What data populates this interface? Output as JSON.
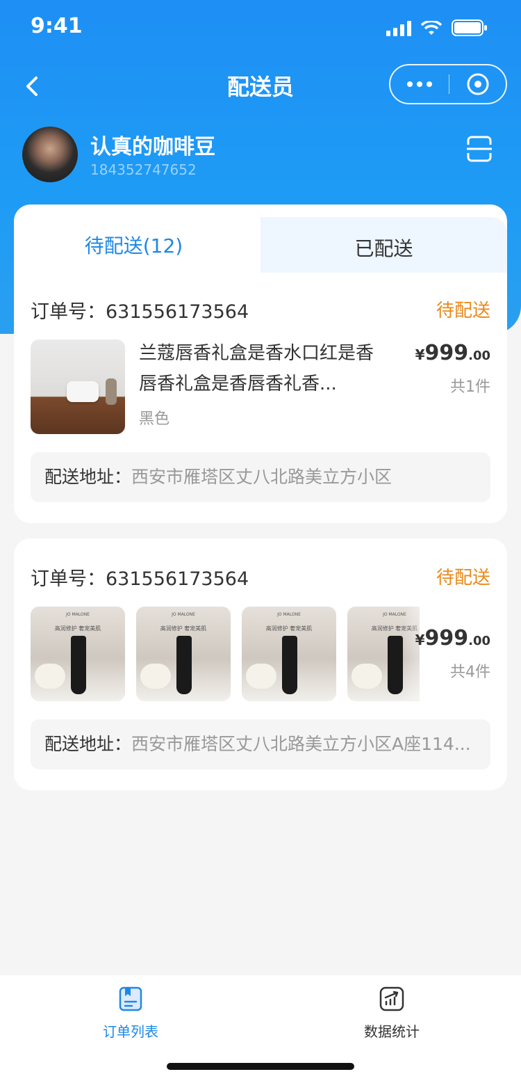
{
  "status_bar": {
    "time": "9:41"
  },
  "nav": {
    "title": "配送员"
  },
  "user": {
    "name": "认真的咖啡豆",
    "phone": "184352747652"
  },
  "tabs": [
    {
      "label": "待配送(12)",
      "active": true
    },
    {
      "label": "已配送",
      "active": false
    }
  ],
  "orders": [
    {
      "order_label": "订单号：",
      "order_no": "631556173564",
      "status": "待配送",
      "product_name": "兰蔻唇香礼盒是香水口红是香唇香礼盒是香唇香礼香...",
      "spec": "黑色",
      "price_symbol": "¥",
      "price_int": "999",
      "price_dec": ".00",
      "count": "共1件",
      "address_label": "配送地址：",
      "address": "西安市雁塔区丈八北路美立方小区"
    },
    {
      "order_label": "订单号：",
      "order_no": "631556173564",
      "status": "待配送",
      "price_symbol": "¥",
      "price_int": "999",
      "price_dec": ".00",
      "count": "共4件",
      "address_label": "配送地址：",
      "address": "西安市雁塔区丈八北路美立方小区A座114..."
    }
  ],
  "product_brand": "JO MALONE",
  "product_tagline": "高润修护 奢宠美肌",
  "tabbar": [
    {
      "label": "订单列表",
      "icon": "order-list-icon",
      "active": true
    },
    {
      "label": "数据统计",
      "icon": "stats-icon",
      "active": false
    }
  ],
  "colors": {
    "primary": "#1e88e5",
    "header_gradient_top": "#1e8ff5",
    "status_orange": "#e88a1a",
    "background": "#f5f5f5"
  }
}
